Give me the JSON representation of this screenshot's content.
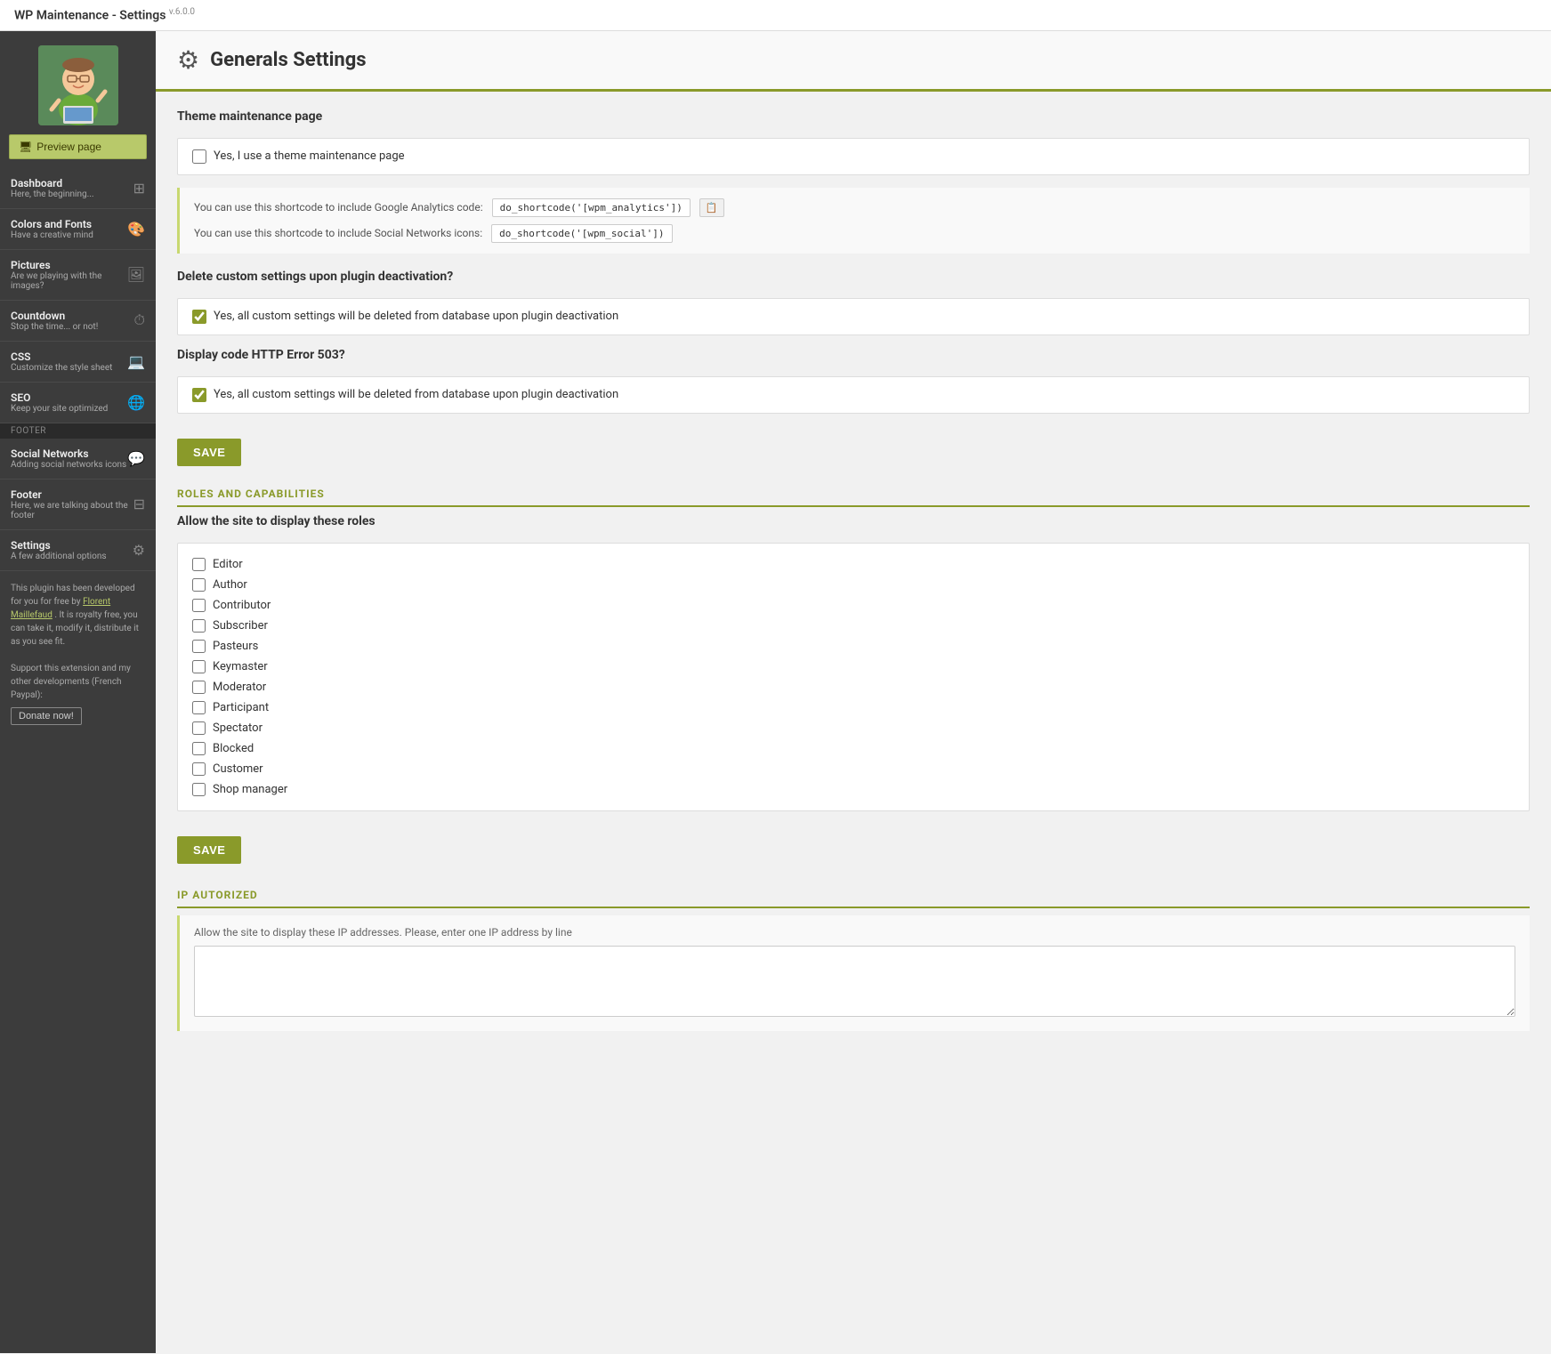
{
  "titleBar": {
    "title": "WP Maintenance - Settings",
    "version": "v.6.0.0"
  },
  "sidebar": {
    "previewButton": "Preview page",
    "items": [
      {
        "id": "dashboard",
        "title": "Dashboard",
        "subtitle": "Here, the beginning...",
        "icon": "⊞"
      },
      {
        "id": "colors-fonts",
        "title": "Colors and Fonts",
        "subtitle": "Have a creative mind",
        "icon": "🎨"
      },
      {
        "id": "pictures",
        "title": "Pictures",
        "subtitle": "Are we playing with the images?",
        "icon": "🖼"
      },
      {
        "id": "countdown",
        "title": "Countdown",
        "subtitle": "Stop the time... or not!",
        "icon": "⏱"
      },
      {
        "id": "css",
        "title": "CSS",
        "subtitle": "Customize the style sheet",
        "icon": "💻"
      },
      {
        "id": "seo",
        "title": "SEO",
        "subtitle": "Keep your site optimized",
        "icon": "🌐"
      }
    ],
    "sectionLabel": "Footer",
    "footerItems": [
      {
        "id": "social-networks",
        "title": "Social Networks",
        "subtitle": "Adding social networks icons",
        "icon": "💬"
      },
      {
        "id": "footer",
        "title": "Footer",
        "subtitle": "Here, we are talking about the footer",
        "icon": "⊟"
      },
      {
        "id": "settings",
        "title": "Settings",
        "subtitle": "A few additional options",
        "icon": "⚙"
      }
    ],
    "pluginText": "This plugin has been developed for you for free by",
    "authorLink": "Florent Maillefaud",
    "pluginText2": ". It is royalty free, you can take it, modify it, distribute it as you see fit.",
    "supportText": "Support this extension and my other developments (French Paypal):",
    "donateLabel": "Donate now!"
  },
  "pageHeader": {
    "icon": "⚙",
    "title": "Generals Settings"
  },
  "sections": {
    "themeMaintenancePage": {
      "title": "Theme maintenance page",
      "checkboxLabel": "Yes, I use a theme maintenance page",
      "shortcodes": [
        {
          "label": "You can use this shortcode to include Google Analytics code:",
          "value": "do_shortcode('[wpm_analytics'])"
        },
        {
          "label": "You can use this shortcode to include Social Networks icons:",
          "value": "do_shortcode('[wpm_social'])"
        }
      ]
    },
    "deleteCustomSettings": {
      "title": "Delete custom settings upon plugin deactivation?",
      "checkboxLabel": "Yes, all custom settings will be deleted from database upon plugin deactivation",
      "checked": true
    },
    "displayHttpError": {
      "title": "Display code HTTP Error 503?",
      "checkboxLabel": "Yes, all custom settings will be deleted from database upon plugin deactivation",
      "checked": true
    },
    "saveButton1": "SAVE",
    "rolesAndCapabilities": {
      "sectionTitle": "ROLES AND CAPABILITIES",
      "subsectionTitle": "Allow the site to display these roles",
      "roles": [
        {
          "label": "Editor",
          "checked": false
        },
        {
          "label": "Author",
          "checked": false
        },
        {
          "label": "Contributor",
          "checked": false
        },
        {
          "label": "Subscriber",
          "checked": false
        },
        {
          "label": "Pasteurs",
          "checked": false
        },
        {
          "label": "Keymaster",
          "checked": false
        },
        {
          "label": "Moderator",
          "checked": false
        },
        {
          "label": "Participant",
          "checked": false
        },
        {
          "label": "Spectator",
          "checked": false
        },
        {
          "label": "Blocked",
          "checked": false
        },
        {
          "label": "Customer",
          "checked": false
        },
        {
          "label": "Shop manager",
          "checked": false
        }
      ]
    },
    "saveButton2": "SAVE",
    "ipAuthorized": {
      "sectionTitle": "IP AUTORIZED",
      "helpText": "Allow the site to display these IP addresses. Please, enter one IP address by line"
    }
  }
}
